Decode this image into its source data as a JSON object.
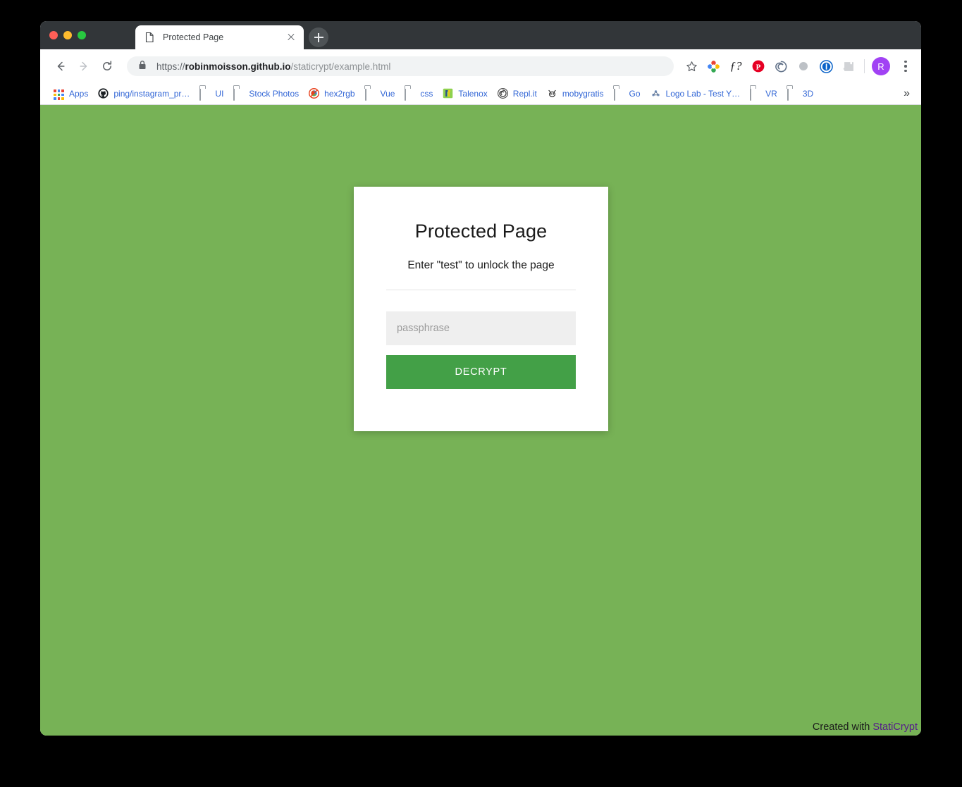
{
  "window": {
    "traffic_lights": [
      "close",
      "minimize",
      "maximize"
    ]
  },
  "tab": {
    "title": "Protected Page",
    "favicon": "document-icon",
    "close_label": "×",
    "newtab_label": "+"
  },
  "toolbar": {
    "back_label": "←",
    "forward_label": "→",
    "reload_label": "⟳",
    "lock_icon": "lock-icon",
    "url": {
      "scheme": "https://",
      "host": "robinmoisson.github.io",
      "path": "/staticrypt/example.html"
    },
    "star_label": "☆",
    "extensions": [
      {
        "name": "colorpick-extension-icon"
      },
      {
        "name": "fontface-ninja-extension-icon",
        "label": "ƒ?"
      },
      {
        "name": "pinterest-extension-icon",
        "label": "P"
      },
      {
        "name": "spiral-extension-icon"
      },
      {
        "name": "grey-dot-extension-icon"
      },
      {
        "name": "onepassword-extension-icon",
        "label": "1"
      },
      {
        "name": "puzzle-extension-icon"
      }
    ],
    "avatar_initial": "R",
    "menu_label": "kebab-menu"
  },
  "bookmarks": {
    "items": [
      {
        "label": "Apps",
        "icon": "apps-grid-icon"
      },
      {
        "label": "ping/instagram_pr…",
        "icon": "github-icon"
      },
      {
        "label": "UI",
        "icon": "folder-icon"
      },
      {
        "label": "Stock Photos",
        "icon": "folder-icon"
      },
      {
        "label": "hex2rgb",
        "icon": "hex2rgb-icon"
      },
      {
        "label": "Vue",
        "icon": "folder-icon"
      },
      {
        "label": "css",
        "icon": "folder-icon"
      },
      {
        "label": "Talenox",
        "icon": "talenox-icon"
      },
      {
        "label": "Repl.it",
        "icon": "replit-icon"
      },
      {
        "label": "mobygratis",
        "icon": "mobygratis-icon"
      },
      {
        "label": "Go",
        "icon": "folder-icon"
      },
      {
        "label": "Logo Lab - Test Y…",
        "icon": "logolab-icon"
      },
      {
        "label": "VR",
        "icon": "folder-icon"
      },
      {
        "label": "3D",
        "icon": "folder-icon"
      }
    ],
    "overflow_label": "»"
  },
  "page": {
    "background_color": "#77b256",
    "card": {
      "title": "Protected Page",
      "subtitle": "Enter \"test\" to unlock the page",
      "passphrase_value": "",
      "passphrase_placeholder": "passphrase",
      "decrypt_label": "DECRYPT",
      "button_color": "#43a047"
    },
    "footer": {
      "text": "Created with ",
      "link_label": "StatiCrypt",
      "link_color": "#551a8b"
    }
  }
}
